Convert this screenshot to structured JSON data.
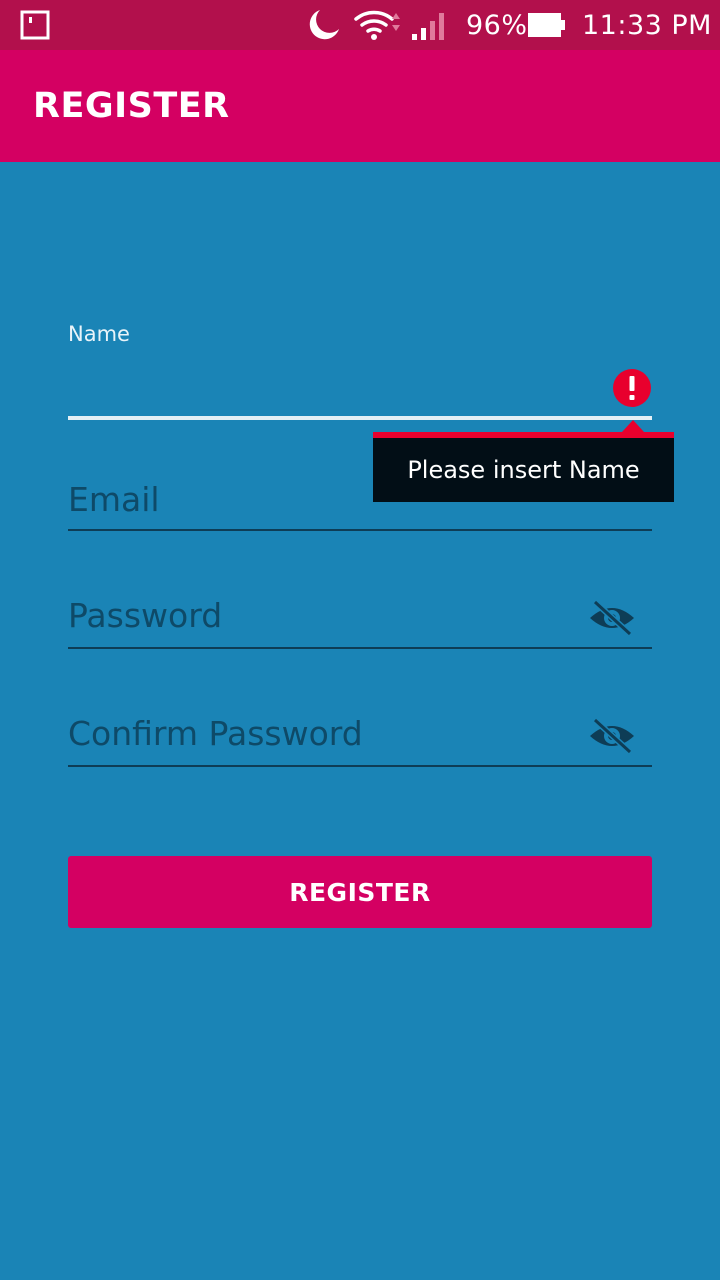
{
  "status_bar": {
    "battery_percent": "96%",
    "time": "11:33 PM",
    "icons": [
      "notification-icon",
      "moon-icon",
      "wifi-icon",
      "signal-icon",
      "battery-icon"
    ]
  },
  "app_bar": {
    "title": "REGISTER"
  },
  "form": {
    "name": {
      "label": "Name",
      "value": "",
      "error": "Please insert Name"
    },
    "email": {
      "placeholder": "Email"
    },
    "password": {
      "placeholder": "Password"
    },
    "confirm_password": {
      "placeholder": "Confirm Password"
    },
    "submit_label": "REGISTER"
  },
  "colors": {
    "status_bar": "#b2104c",
    "app_bar": "#d40062",
    "background": "#1a84b6",
    "button": "#d40062",
    "error": "#e8002d",
    "tooltip": "#020e16"
  }
}
